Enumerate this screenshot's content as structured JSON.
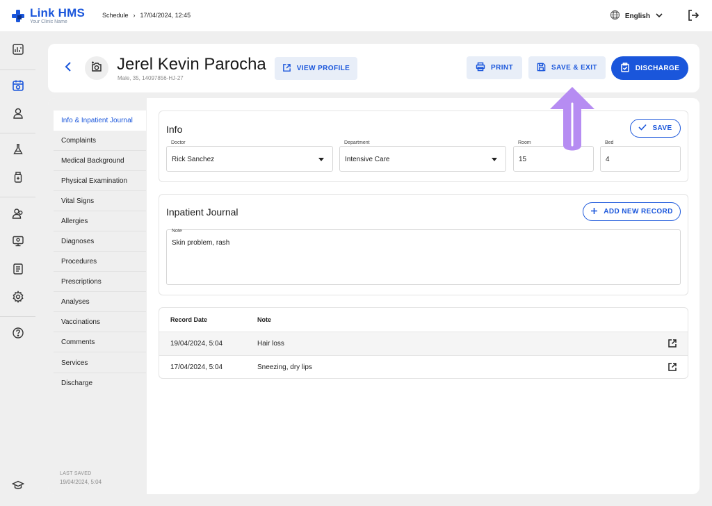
{
  "app": {
    "brand_name": "Link HMS",
    "brand_subtitle": "Your Clinic Name",
    "accent_color": "#1a56db"
  },
  "breadcrumb": {
    "section": "Schedule",
    "separator": "›",
    "current": "17/04/2024, 12:45"
  },
  "language": {
    "selected": "English"
  },
  "sidebar": {
    "items": [
      {
        "icon": "dashboard-icon"
      },
      {
        "icon": "schedule-icon",
        "active": true
      },
      {
        "icon": "patient-icon"
      },
      {
        "icon": "lab-flask-icon"
      },
      {
        "icon": "medicine-bottle-icon"
      },
      {
        "icon": "staff-group-icon"
      },
      {
        "icon": "monitor-icon"
      },
      {
        "icon": "report-icon"
      },
      {
        "icon": "settings-gear-icon"
      },
      {
        "icon": "help-icon"
      },
      {
        "icon": "graduation-cap-icon"
      }
    ]
  },
  "patient": {
    "name": "Jerel Kevin Parocha",
    "meta": "Male, 35, 14097856-HJ-27"
  },
  "header_actions": {
    "view_profile": "VIEW PROFILE",
    "print": "PRINT",
    "save_exit": "SAVE & EXIT",
    "discharge": "DISCHARGE"
  },
  "nav": {
    "items": [
      "Info & Inpatient Journal",
      "Complaints",
      "Medical Background",
      "Physical Examination",
      "Vital Signs",
      "Allergies",
      "Diagnoses",
      "Procedures",
      "Prescriptions",
      "Analyses",
      "Vaccinations",
      "Comments",
      "Services",
      "Discharge"
    ],
    "active_index": 0,
    "last_saved_label": "LAST SAVED",
    "last_saved_value": "19/04/2024, 5:04"
  },
  "info": {
    "title": "Info",
    "save_label": "SAVE",
    "doctor_label": "Doctor",
    "doctor_value": "Rick Sanchez",
    "department_label": "Department",
    "department_value": "Intensive Care",
    "room_label": "Room",
    "room_value": "15",
    "bed_label": "Bed",
    "bed_value": "4"
  },
  "journal": {
    "title": "Inpatient Journal",
    "add_label": "ADD NEW RECORD",
    "note_label": "Note",
    "note_value": "Skin problem, rash"
  },
  "records": {
    "col_date": "Record Date",
    "col_note": "Note",
    "rows": [
      {
        "date": "19/04/2024, 5:04",
        "note": "Hair loss"
      },
      {
        "date": "17/04/2024, 5:04",
        "note": "Sneezing, dry lips"
      }
    ]
  }
}
